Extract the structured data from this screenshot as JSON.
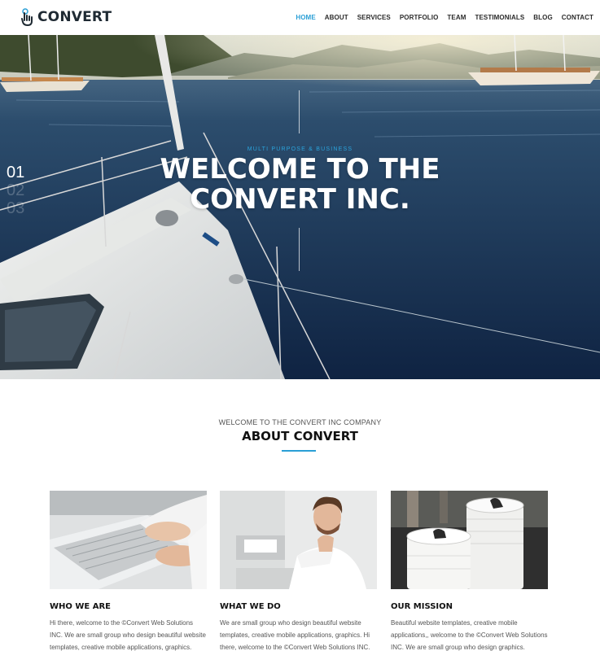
{
  "brand": {
    "name": "CONVERT",
    "accent": "#2a9fd6"
  },
  "nav": {
    "items": [
      {
        "label": "HOME",
        "active": true
      },
      {
        "label": "ABOUT"
      },
      {
        "label": "SERVICES"
      },
      {
        "label": "PORTFOLIO"
      },
      {
        "label": "TEAM"
      },
      {
        "label": "TESTIMONIALS"
      },
      {
        "label": "BLOG"
      },
      {
        "label": "CONTACT"
      }
    ]
  },
  "hero": {
    "kicker": "MULTI PURPOSE & BUSINESS",
    "title_line1": "WELCOME TO THE",
    "title_line2": "CONVERT INC.",
    "slides": [
      "01",
      "02",
      "03"
    ],
    "active_slide": "01"
  },
  "about": {
    "kicker": "WELCOME TO THE CONVERT INC COMPANY",
    "title": "ABOUT CONVERT",
    "cards": [
      {
        "title": "WHO WE ARE",
        "text": "Hi there, welcome to the ©Convert Web Solutions INC. We are small group who design beautiful website templates, creative mobile applications, graphics."
      },
      {
        "title": "WHAT WE DO",
        "text": "We are small group who design beautiful website templates, creative mobile applications, graphics. Hi there, welcome to the ©Convert Web Solutions INC."
      },
      {
        "title": "OUR MISSION",
        "text": "Beautiful website templates, creative mobile applications,, welcome to the ©Convert Web Solutions INC. We are small group who design graphics."
      }
    ]
  }
}
